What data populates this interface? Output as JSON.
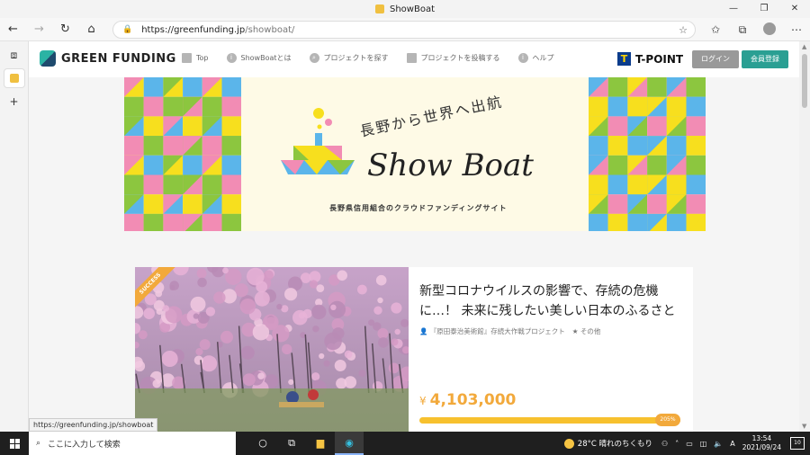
{
  "window": {
    "title": "ShowBoat",
    "controls": [
      "—",
      "❐",
      "✕"
    ]
  },
  "browser": {
    "url_host": "https://greenfunding.jp",
    "url_path": "/showboat/",
    "status_url": "https://greenfunding.jp/showboat"
  },
  "site": {
    "logo": "GREEN FUNDING",
    "nav": [
      {
        "label": "Top",
        "icon": "home-icon"
      },
      {
        "label": "ShowBoatとは",
        "icon": "info-icon"
      },
      {
        "label": "プロジェクトを探す",
        "icon": "search-icon"
      },
      {
        "label": "プロジェクトを投稿する",
        "icon": "document-icon"
      },
      {
        "label": "ヘルプ",
        "icon": "info-icon"
      }
    ],
    "tpoint": "T-POINT",
    "login": "ログイン",
    "register": "会員登録"
  },
  "banner": {
    "subtitle": "長野から世界へ出航",
    "title": "Show Boat",
    "tagline": "長野県信用組合のクラウドファンディングサイト",
    "colors": {
      "yellow": "#f7df1e",
      "pink": "#f28cb4",
      "blue": "#5bb5ea",
      "green": "#8cc63f"
    }
  },
  "project": {
    "badge": "SUCCESS",
    "title": "新型コロナウイルスの影響で、存続の危機に…！ 未来に残したい美しい日本のふるさと",
    "owner": "『原田泰治美術館』存続大作戦プロジェクト",
    "category": "その他",
    "currency": "¥",
    "amount": "4,103,000",
    "percent_label": "205%",
    "progress_fraction": 1.0
  },
  "taskbar": {
    "search_placeholder": "ここに入力して検索",
    "weather": "28°C  晴れのちくもり",
    "ime": "A",
    "time": "13:54",
    "date": "2021/09/24",
    "notif": "10"
  },
  "colors": {
    "accent": "#2a9f93",
    "orange": "#f2a93b"
  }
}
